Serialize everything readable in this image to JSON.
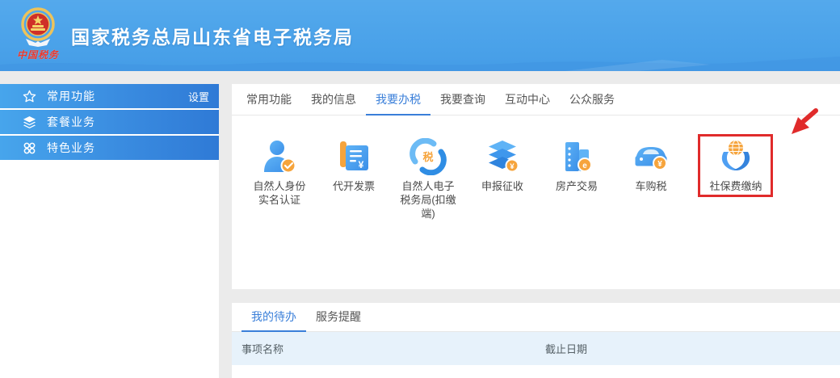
{
  "header": {
    "title": "国家税务总局山东省电子税务局",
    "logo_caption": "中国税务"
  },
  "sidebar": {
    "items": [
      {
        "label": "常用功能",
        "action": "设置"
      },
      {
        "label": "套餐业务",
        "action": ""
      },
      {
        "label": "特色业务",
        "action": ""
      }
    ]
  },
  "workspace": {
    "tabs": [
      {
        "label": "常用功能"
      },
      {
        "label": "我的信息"
      },
      {
        "label": "我要办税"
      },
      {
        "label": "我要查询"
      },
      {
        "label": "互动中心"
      },
      {
        "label": "公众服务"
      }
    ],
    "active_tab": "我要办税",
    "services": [
      {
        "label": "自然人身份\n实名认证"
      },
      {
        "label": "代开发票"
      },
      {
        "label": "自然人电子\n税务局(扣缴\n端)"
      },
      {
        "label": "申报征收"
      },
      {
        "label": "房产交易"
      },
      {
        "label": "车购税"
      },
      {
        "label": "社保费缴纳",
        "highlighted": true
      }
    ],
    "tax_char": "税"
  },
  "todo": {
    "tabs": [
      {
        "label": "我的待办"
      },
      {
        "label": "服务提醒"
      }
    ],
    "active_tab": "我的待办",
    "columns": [
      "事项名称",
      "截止日期"
    ],
    "rows": []
  },
  "colors": {
    "accent_blue": "#3a7fd9",
    "header_blue": "#49a1e9",
    "sidebar_gradient_start": "#47a5ec",
    "sidebar_gradient_end": "#2f7ad6",
    "icon_blue": "#4aa0f0",
    "icon_orange": "#f6a43c",
    "highlight_red": "#e02b2b",
    "table_header_bg": "#e7f2fb"
  }
}
